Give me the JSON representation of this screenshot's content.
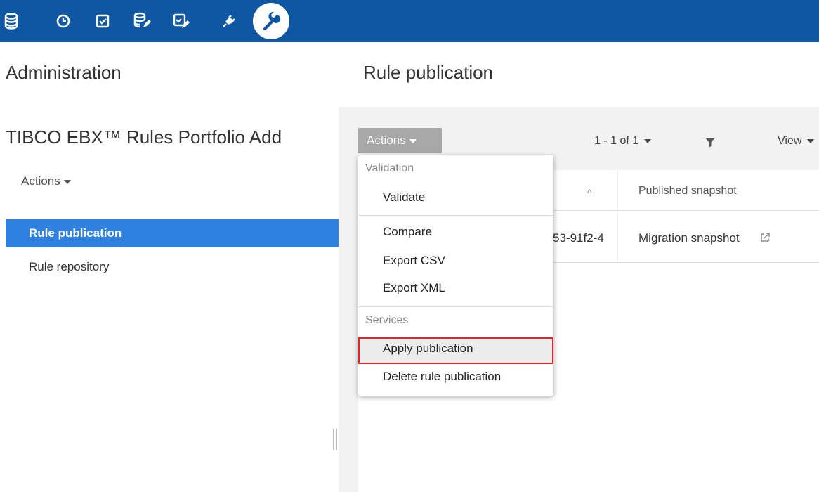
{
  "topbar": {
    "icons": [
      "database-icon",
      "clock-icon",
      "checkbox-icon",
      "database-edit-icon",
      "checkbox-edit-icon",
      "plug-icon",
      "wrench-icon"
    ],
    "bg_color": "#0f57a3",
    "active_icon": "wrench-icon"
  },
  "left": {
    "title": "Administration",
    "portfolio_title": "TIBCO EBX™ Rules Portfolio Add",
    "actions_label": "Actions",
    "nav": [
      {
        "label": "Rule publication",
        "active": true
      },
      {
        "label": "Rule repository",
        "active": false
      }
    ]
  },
  "main": {
    "title": "Rule publication",
    "actions_label": "Actions",
    "pager": "1 - 1 of 1",
    "view_label": "View",
    "columns": {
      "published": "Published snapshot"
    },
    "rows": [
      {
        "id": "53-91f2-4",
        "snapshot": "Migration snapshot"
      }
    ]
  },
  "menu": {
    "groups": [
      {
        "title": "Validation",
        "items": [
          "Validate"
        ]
      },
      {
        "title": "",
        "items": [
          "Compare",
          "Export CSV",
          "Export XML"
        ]
      },
      {
        "title": "Services",
        "items": [
          "Apply publication",
          "Delete rule publication"
        ]
      }
    ],
    "highlighted_item": "Apply publication",
    "highlight_color": "#e8232a"
  },
  "colors": {
    "nav_active": "#2f80df",
    "actions_button": "#a8a8a8"
  }
}
